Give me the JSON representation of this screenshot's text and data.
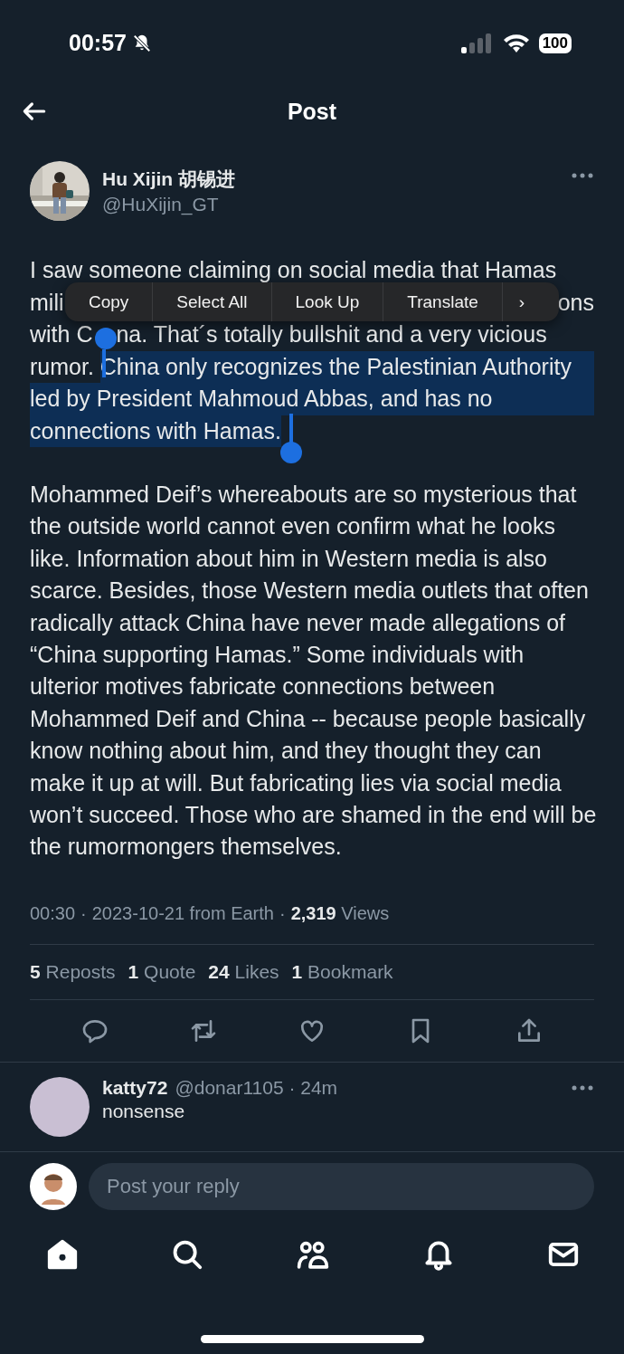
{
  "status_bar": {
    "time": "00:57",
    "muted": true,
    "battery": "100"
  },
  "header": {
    "title": "Post"
  },
  "author": {
    "name": "Hu Xijin 胡锡进",
    "handle": "@HuXijin_GT"
  },
  "first_paragraph": [
    {
      "kind": "flow",
      "parts": [
        {
          "text": "I saw someone claiming on social media that Hamas",
          "selected": false
        }
      ]
    },
    {
      "kind": "split",
      "parts": [
        {
          "text": "mili",
          "selected": false
        },
        {
          "text": "ons",
          "selected": false
        }
      ]
    },
    {
      "kind": "split",
      "parts": [
        {
          "text": "with C",
          "selected": false
        },
        {
          "text": "na. That´s totally bullshit and a very vicious",
          "selected": false
        }
      ]
    },
    {
      "kind": "flow",
      "parts": [
        {
          "text": "rumor. ",
          "selected": false
        },
        {
          "text": "China only recognizes the Palestinian Authority",
          "selected": true
        }
      ]
    },
    {
      "kind": "flow",
      "parts": [
        {
          "text": "led by President Mahmoud Abbas, and has no",
          "selected": true
        }
      ]
    },
    {
      "kind": "flow",
      "parts": [
        {
          "text": "connections with Hamas.",
          "selected": true
        }
      ]
    }
  ],
  "context_menu": {
    "items": [
      "Copy",
      "Select All",
      "Look Up",
      "Translate"
    ],
    "more": "›"
  },
  "second_paragraph": "Mohammed Deif’s whereabouts are so mysterious that the outside world cannot even confirm what he looks like. Information about him in Western media is also scarce. Besides, those Western media outlets that often radically attack China have never made allegations of “China supporting Hamas.” Some individuals with ulterior motives fabricate connections between Mohammed Deif and China -- because people basically know nothing about him, and they thought they can make it up at will. But fabricating lies via social media won’t succeed. Those who are shamed in the end will be the rumormongers themselves.",
  "meta": {
    "time": "00:30",
    "date": "2023-10-21 from Earth",
    "views_count": "2,319",
    "views_label": "Views"
  },
  "stats": [
    {
      "count": "5",
      "label": "Reposts"
    },
    {
      "count": "1",
      "label": "Quote"
    },
    {
      "count": "24",
      "label": "Likes"
    },
    {
      "count": "1",
      "label": "Bookmark"
    }
  ],
  "actions": [
    {
      "kind": "reply"
    },
    {
      "kind": "repost"
    },
    {
      "kind": "like"
    },
    {
      "kind": "bookmark"
    },
    {
      "kind": "share"
    }
  ],
  "reply": {
    "name": "katty72",
    "handle": "@donar1105",
    "separator": "·",
    "age": "24m",
    "text": "nonsense"
  },
  "composer": {
    "placeholder": "Post your reply"
  },
  "nav": [
    {
      "kind": "home",
      "selected": true
    },
    {
      "kind": "search",
      "selected": false
    },
    {
      "kind": "communities",
      "selected": false
    },
    {
      "kind": "notifications",
      "selected": false
    },
    {
      "kind": "messages",
      "selected": false
    }
  ]
}
